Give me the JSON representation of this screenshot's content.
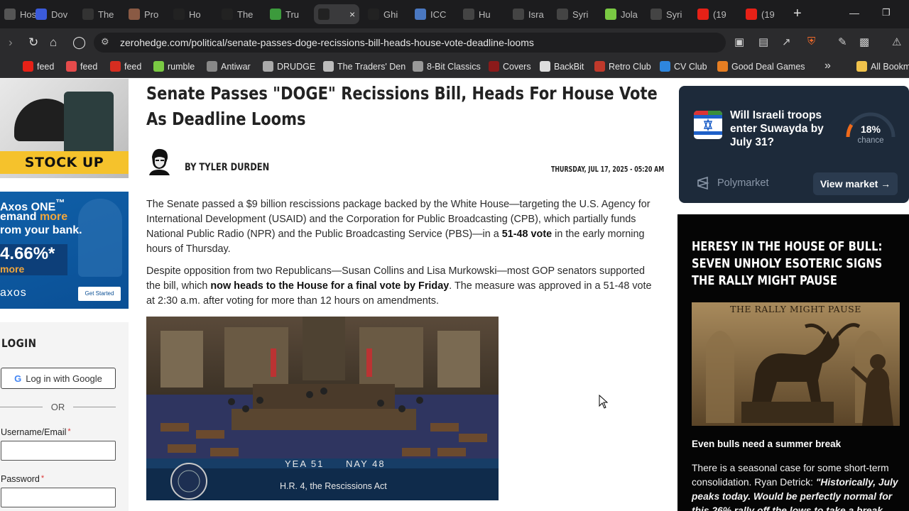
{
  "browser": {
    "tabs": [
      {
        "label": "Hos",
        "icon": "generic-favicon",
        "color": "#555555"
      },
      {
        "label": "Dov",
        "icon": "r-favicon",
        "color": "#3b5bdb"
      },
      {
        "label": "The",
        "icon": "shirt-favicon",
        "color": "#333333"
      },
      {
        "label": "Pro",
        "icon": "image-favicon",
        "color": "#8a5a44"
      },
      {
        "label": "Ho",
        "icon": "zh-favicon",
        "color": "#222222"
      },
      {
        "label": "The",
        "icon": "zh-favicon",
        "color": "#222222"
      },
      {
        "label": "Tru",
        "icon": "rt-favicon",
        "color": "#3c9a3c"
      },
      {
        "label": "",
        "icon": "zh-favicon",
        "color": "#222222",
        "active": true
      },
      {
        "label": "Ghi",
        "icon": "zh-favicon",
        "color": "#222222"
      },
      {
        "label": "ICC",
        "icon": "icc-favicon",
        "color": "#4a78c2"
      },
      {
        "label": "Hu",
        "icon": "news-favicon",
        "color": "#444444"
      },
      {
        "label": "Isra",
        "icon": "news-favicon",
        "color": "#444444"
      },
      {
        "label": "Syri",
        "icon": "news-favicon",
        "color": "#444444"
      },
      {
        "label": "Jola",
        "icon": "rumble-favicon",
        "color": "#7ac943"
      },
      {
        "label": "Syri",
        "icon": "news-favicon",
        "color": "#444444"
      },
      {
        "label": "(19",
        "icon": "youtube-favicon",
        "color": "#e62117"
      },
      {
        "label": "(19",
        "icon": "youtube-favicon",
        "color": "#e62117"
      }
    ],
    "url": "zerohedge.com/political/senate-passes-doge-recissions-bill-heads-house-vote-deadline-looms",
    "bookmarks": [
      {
        "label": "feed",
        "color": "#e62117"
      },
      {
        "label": "feed",
        "color": "#e54b4b"
      },
      {
        "label": "feed",
        "color": "#d62d20"
      },
      {
        "label": "rumble",
        "color": "#7ac943"
      },
      {
        "label": "Antiwar",
        "color": "#888888"
      },
      {
        "label": "DRUDGE",
        "color": "#aaaaaa"
      },
      {
        "label": "The Traders' Den",
        "color": "#bbbbbb"
      },
      {
        "label": "8-Bit Classics",
        "color": "#999999"
      },
      {
        "label": "Covers",
        "color": "#8b1a1a"
      },
      {
        "label": "BackBit",
        "color": "#dddddd"
      },
      {
        "label": "Retro Club",
        "color": "#c0392b"
      },
      {
        "label": "CV Club",
        "color": "#2e86de"
      },
      {
        "label": "Good Deal Games",
        "color": "#e67e22"
      },
      {
        "label": "All Bookm",
        "color": "#f0c24b"
      }
    ]
  },
  "left": {
    "ad1_text": "STOCK UP",
    "ad2": {
      "line1": "Axos ONE",
      "line1_mark": "™",
      "line2a": "emand ",
      "line2b": "more",
      "line3": "rom your bank.",
      "rate": "4.66%*",
      "rate_sub": "more",
      "logo": "axos",
      "cta": "Get Started"
    },
    "login": {
      "heading": "LOGIN",
      "google_button": "Log in with Google",
      "or": "OR",
      "username_label": "Username/Email",
      "password_label": "Password",
      "required_mark": "*"
    }
  },
  "article": {
    "title": "Senate Passes \"DOGE\" Recissions Bill, Heads For House Vote As Deadline Looms",
    "byline": "BY TYLER DURDEN",
    "date": "THURSDAY, JUL 17, 2025 - 05:20 AM",
    "p1": {
      "a": "The Senate passed a $9 billion rescissions package backed by the White House—targeting the U.S. Agency for International Development (USAID) and the Corporation for Public Broadcasting (CPB), which partially funds National Public Radio (NPR) and the Public Broadcasting Service (PBS)—in a ",
      "b": "51-48 vote",
      "c": " in the early morning hours of Thursday."
    },
    "p2": {
      "a": "Despite opposition from two Republicans—Susan Collins and Lisa Murkowski—most GOP senators supported the bill, which ",
      "b": "now heads to the House for a final vote by Friday",
      "c": ". The measure was approved in a 51-48 vote at 2:30 a.m. after voting for more than 12 hours on amendments."
    },
    "photo": {
      "yea": "YEA 51",
      "nay": "NAY 48",
      "caption": "H.R. 4, the Rescissions Act"
    }
  },
  "right": {
    "poly": {
      "question": "Will Israeli troops enter Suwayda by July 31?",
      "percent": "18%",
      "percent_value": 18,
      "chance": "chance",
      "brand": "Polymarket",
      "view": "View market →"
    },
    "heresy": {
      "heading": "HERESY IN THE HOUSE OF BULL: SEVEN UNHOLY ESOTERIC SIGNS THE RALLY MIGHT PAUSE",
      "image_text": "THE RALLY MIGHT PAUSE",
      "subheading": "Even bulls need a summer break",
      "body_a": "There is a seasonal case for some short-term consolidation. Ryan Detrick: ",
      "body_b": "\"Historically, July peaks today. Would be perfectly normal for this 26% rally off the lows to take a break about"
    }
  }
}
